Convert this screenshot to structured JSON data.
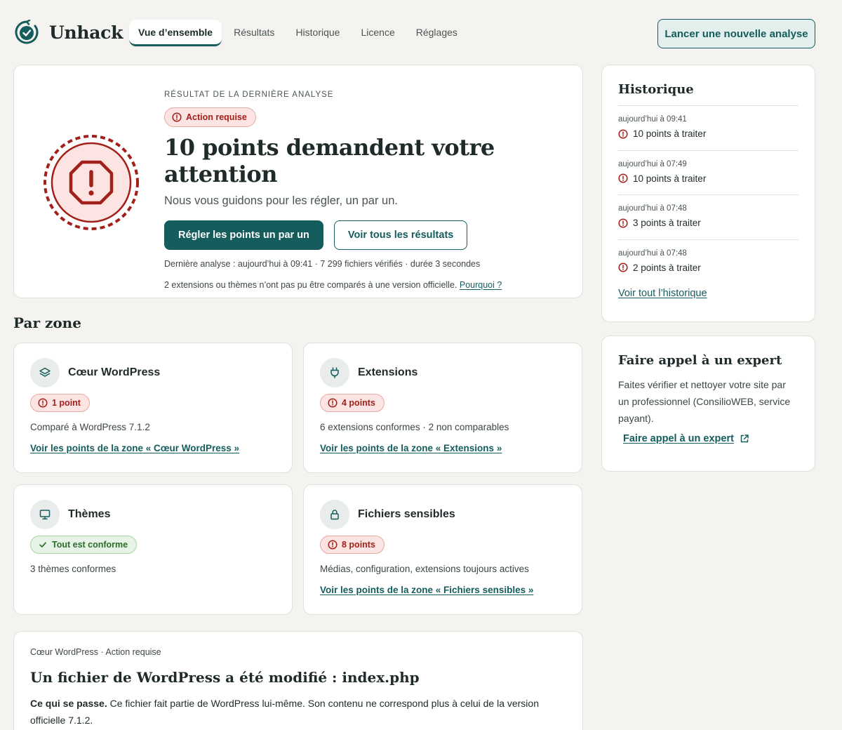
{
  "app": {
    "name": "Unhack"
  },
  "nav": {
    "tabs": [
      {
        "label": "Vue d’ensemble",
        "active": true
      },
      {
        "label": "Résultats",
        "active": false
      },
      {
        "label": "Historique",
        "active": false
      },
      {
        "label": "Licence",
        "active": false
      },
      {
        "label": "Réglages",
        "active": false
      }
    ],
    "new_scan_label": "Lancer une nouvelle analyse"
  },
  "hero": {
    "eyebrow": "Résultat de la dernière analyse",
    "badge": "Action requise",
    "title": "10 points demandent votre attention",
    "subtitle": "Nous vous guidons pour les régler, un par un.",
    "primary_label": "Régler les points un par un",
    "secondary_label": "Voir tous les résultats",
    "meta": "Dernière analyse : aujourd’hui à 09:41 · 7 299 fichiers vérifiés · durée 3 secondes",
    "note": "2 extensions ou thèmes n’ont pas pu être comparés à une version officielle.",
    "note_link": "Pourquoi ?"
  },
  "history": {
    "title": "Historique",
    "items": [
      {
        "time": "aujourd’hui à 09:41",
        "count": "10 points à traiter"
      },
      {
        "time": "aujourd’hui à 07:49",
        "count": "10 points à traiter"
      },
      {
        "time": "aujourd’hui à 07:48",
        "count": "3 points à traiter"
      },
      {
        "time": "aujourd’hui à 07:48",
        "count": "2 points à traiter"
      }
    ],
    "link": "Voir tout l’historique"
  },
  "zones": {
    "title": "Par zone",
    "items": [
      {
        "name": "Cœur WordPress",
        "icon": "layers-icon",
        "badge": "1 point",
        "status": "warning",
        "desc": "Comparé à WordPress 7.1.2",
        "link": "Voir les points de la zone « Cœur WordPress »"
      },
      {
        "name": "Extensions",
        "icon": "plug-icon",
        "badge": "4 points",
        "status": "warning",
        "desc": "6 extensions conformes · 2 non comparables",
        "link": "Voir les points de la zone « Extensions »"
      },
      {
        "name": "Thèmes",
        "icon": "monitor-icon",
        "badge": "Tout est conforme",
        "status": "ok",
        "desc": "3 thèmes conformes",
        "link": ""
      },
      {
        "name": "Fichiers sensibles",
        "icon": "lock-icon",
        "badge": "8 points",
        "status": "warning",
        "desc": "Médias, configuration, extensions toujours actives",
        "link": "Voir les points de la zone « Fichiers sensibles »"
      }
    ]
  },
  "expert": {
    "title": "Faire appel à un expert",
    "text": "Faites vérifier et nettoyer votre site par un professionnel (ConsilioWEB, service payant).",
    "link": "Faire appel à un expert"
  },
  "issue": {
    "meta": "Cœur WordPress · Action requise",
    "title": "Un fichier de WordPress a été modifié : index.php",
    "lead": "Ce qui se passe.",
    "text": " Ce fichier fait partie de WordPress lui-même. Son contenu ne correspond plus à celui de la version officielle 7.1.2."
  },
  "colors": {
    "accent": "#155c5c",
    "danger": "#a31f1a",
    "danger_bg": "#fbe4e2",
    "success": "#2a6e2a",
    "background": "#f4f3ef"
  }
}
